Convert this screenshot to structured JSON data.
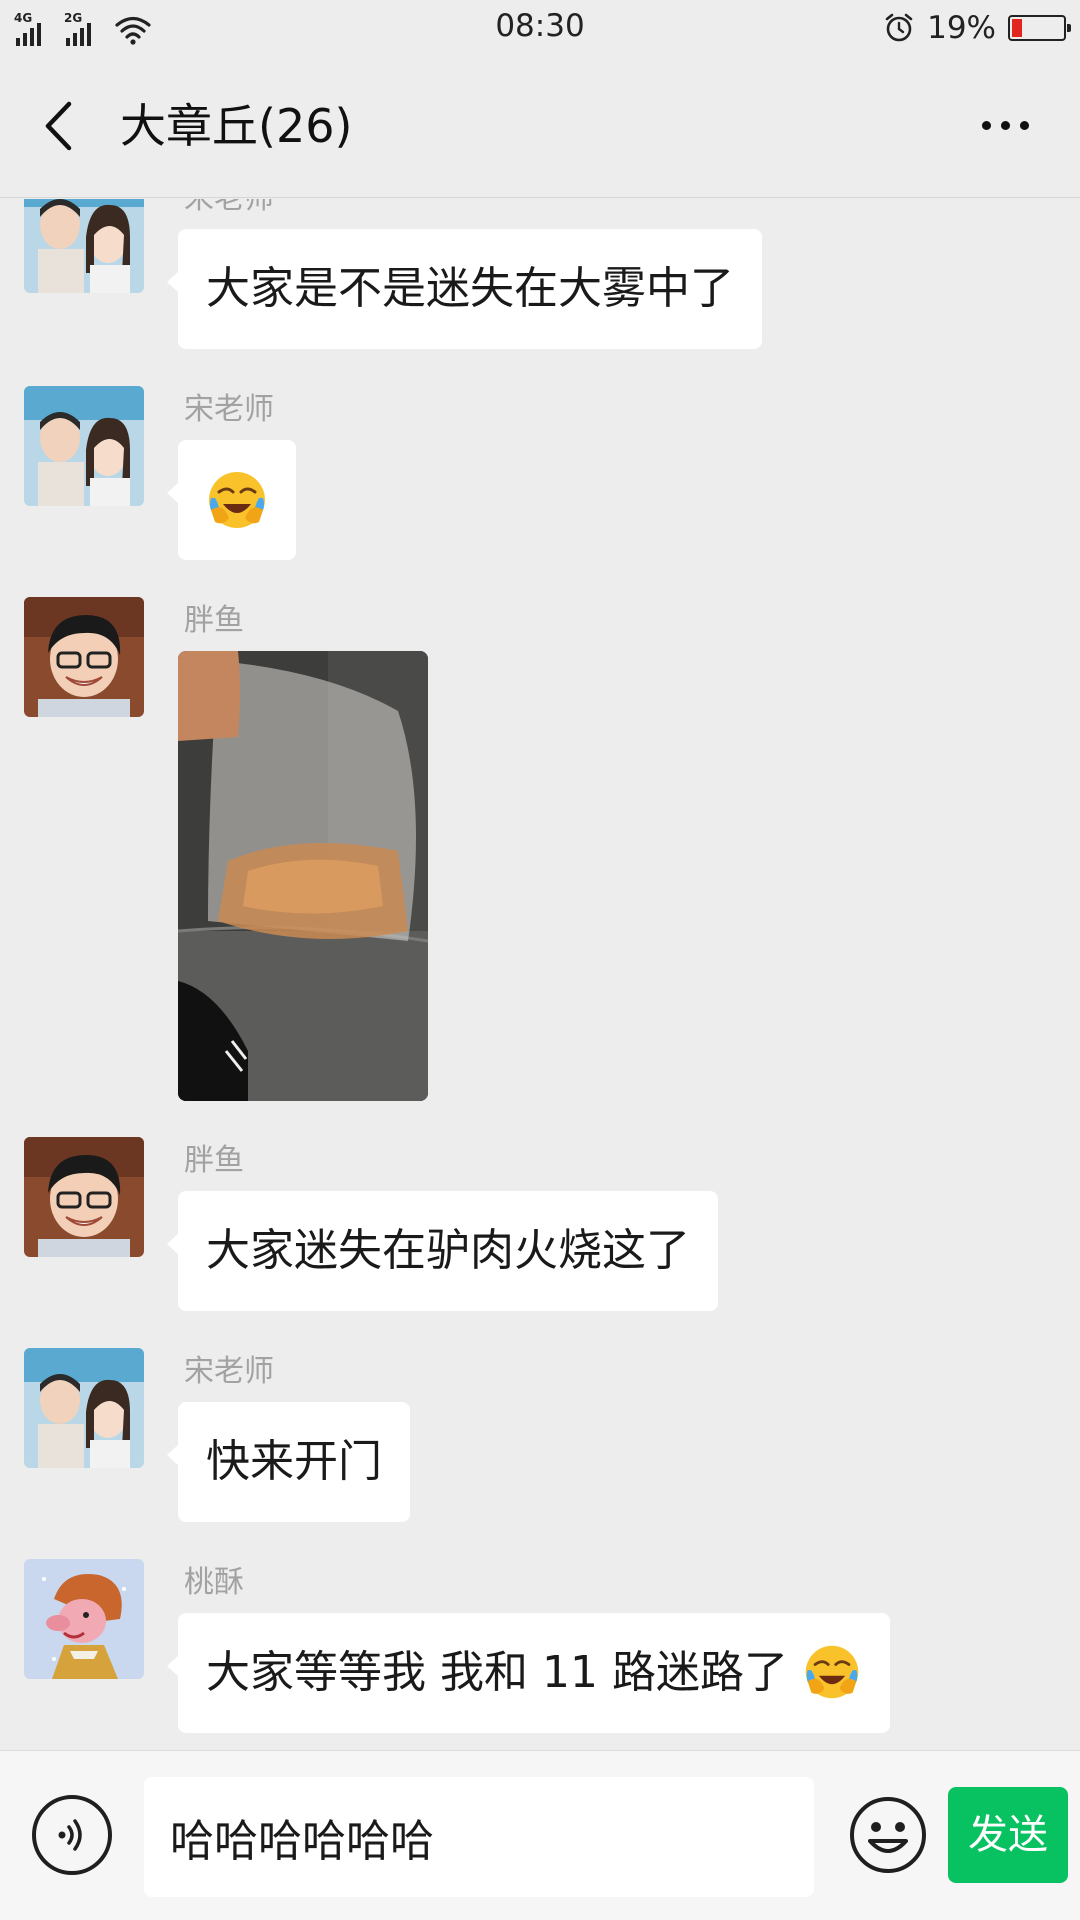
{
  "status_bar": {
    "network_1": "4G",
    "network_2": "2G",
    "time": "08:30",
    "battery_percent": "19%",
    "battery_level": 0.19,
    "icons": [
      "signal-icon",
      "wifi-icon",
      "alarm-icon",
      "battery-icon"
    ]
  },
  "header": {
    "title": "大章丘(26)",
    "back_icon": "chevron-left-icon",
    "more_icon": "more-dots-icon"
  },
  "messages": [
    {
      "sender": "宋老师",
      "type": "text",
      "text": "大家是不是迷失在大雾中了"
    },
    {
      "sender": "宋老师",
      "type": "emoji",
      "emoji": "😭"
    },
    {
      "sender": "胖鱼",
      "type": "image"
    },
    {
      "sender": "胖鱼",
      "type": "text",
      "text": "大家迷失在驴肉火烧这了"
    },
    {
      "sender": "宋老师",
      "type": "text",
      "text": "快来开门"
    },
    {
      "sender": "桃酥",
      "type": "text",
      "text": "大家等等我 我和 11 路迷路了",
      "emoji": "😭"
    }
  ],
  "input_bar": {
    "text_value": "哈哈哈哈哈哈",
    "send_label": "发送",
    "voice_icon": "voice-icon",
    "emoji_icon": "emoji-icon"
  },
  "colors": {
    "background": "#ededed",
    "bubble": "#ffffff",
    "send_button": "#08c160",
    "sender_name": "#a2a2a2",
    "battery_low": "#e0261f"
  }
}
